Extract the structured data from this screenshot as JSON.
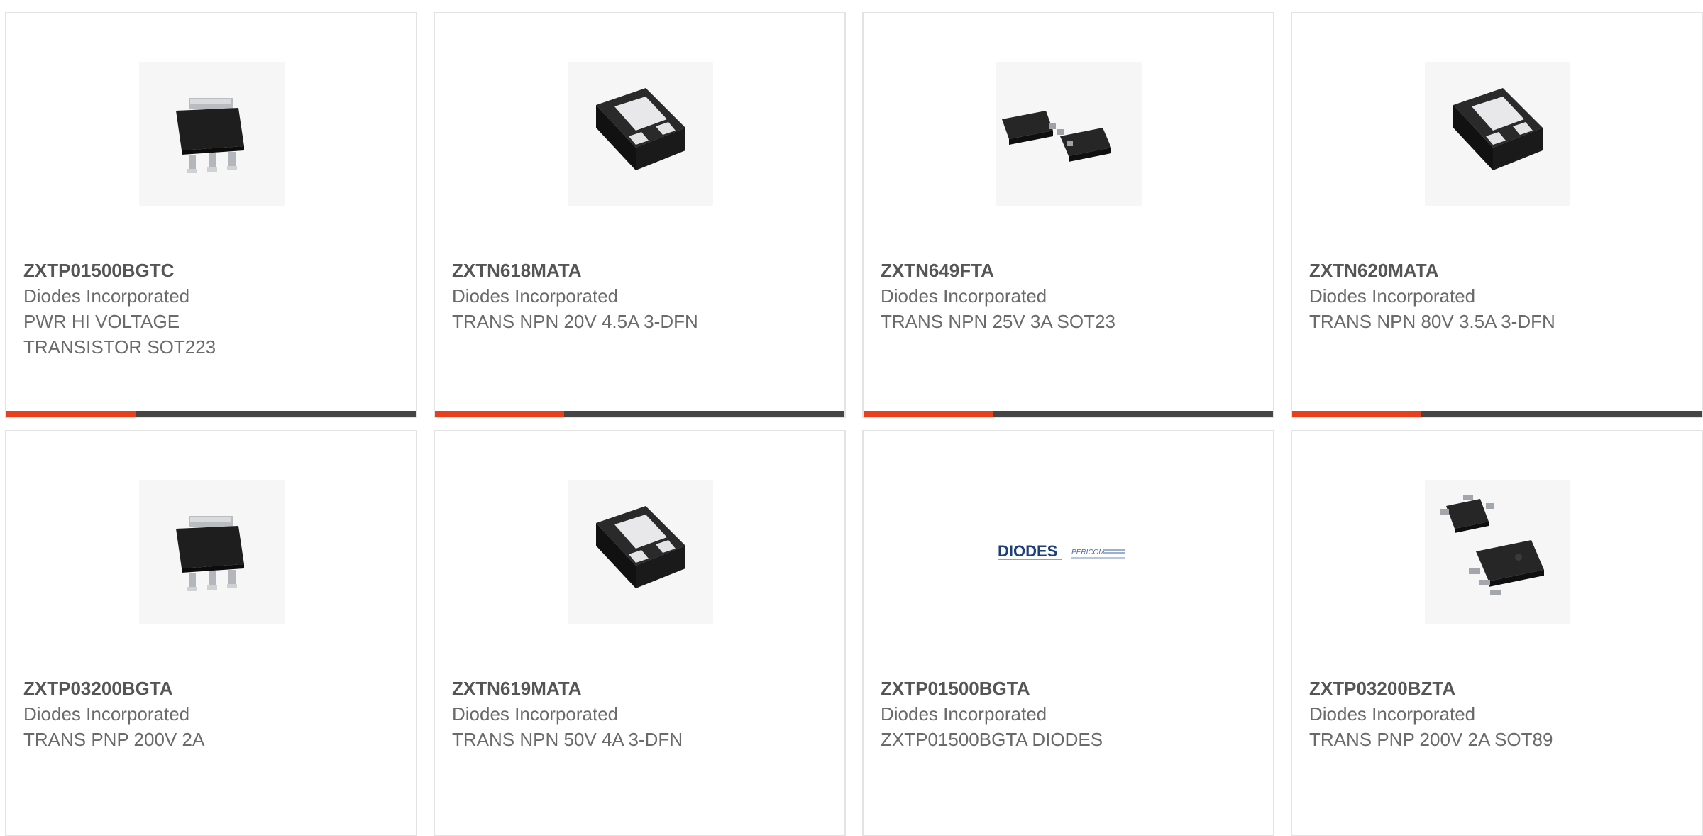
{
  "colors": {
    "accent": "#e8401c",
    "bar": "#454545",
    "border": "#e3e3e3"
  },
  "products": [
    {
      "part_number": "ZXTP01500BGTC",
      "manufacturer": "Diodes Incorporated",
      "description": "PWR HI VOLTAGE TRANSISTOR SOT223",
      "image": "sot223-package-icon"
    },
    {
      "part_number": "ZXTN618MATA",
      "manufacturer": "Diodes Incorporated",
      "description": "TRANS NPN 20V 4.5A 3-DFN",
      "image": "dfn-package-icon"
    },
    {
      "part_number": "ZXTN649FTA",
      "manufacturer": "Diodes Incorporated",
      "description": "TRANS NPN 25V 3A SOT23",
      "image": "sot23-package-icon"
    },
    {
      "part_number": "ZXTN620MATA",
      "manufacturer": "Diodes Incorporated",
      "description": "TRANS NPN 80V 3.5A 3-DFN",
      "image": "dfn-package-icon"
    },
    {
      "part_number": "ZXTP03200BGTA",
      "manufacturer": "Diodes Incorporated",
      "description": "TRANS PNP 200V 2A",
      "image": "sot223-package-icon"
    },
    {
      "part_number": "ZXTN619MATA",
      "manufacturer": "Diodes Incorporated",
      "description": "TRANS NPN 50V 4A 3-DFN",
      "image": "dfn-package-icon"
    },
    {
      "part_number": "ZXTP01500BGTA",
      "manufacturer": "Diodes Incorporated",
      "description": "ZXTP01500BGTA DIODES",
      "image": "diodes-pericom-logo",
      "logo_text": "DIODES",
      "logo_text_2": "PERICOM"
    },
    {
      "part_number": "ZXTP03200BZTA",
      "manufacturer": "Diodes Incorporated",
      "description": "TRANS PNP 200V 2A SOT89",
      "image": "sot89-package-icon"
    }
  ]
}
